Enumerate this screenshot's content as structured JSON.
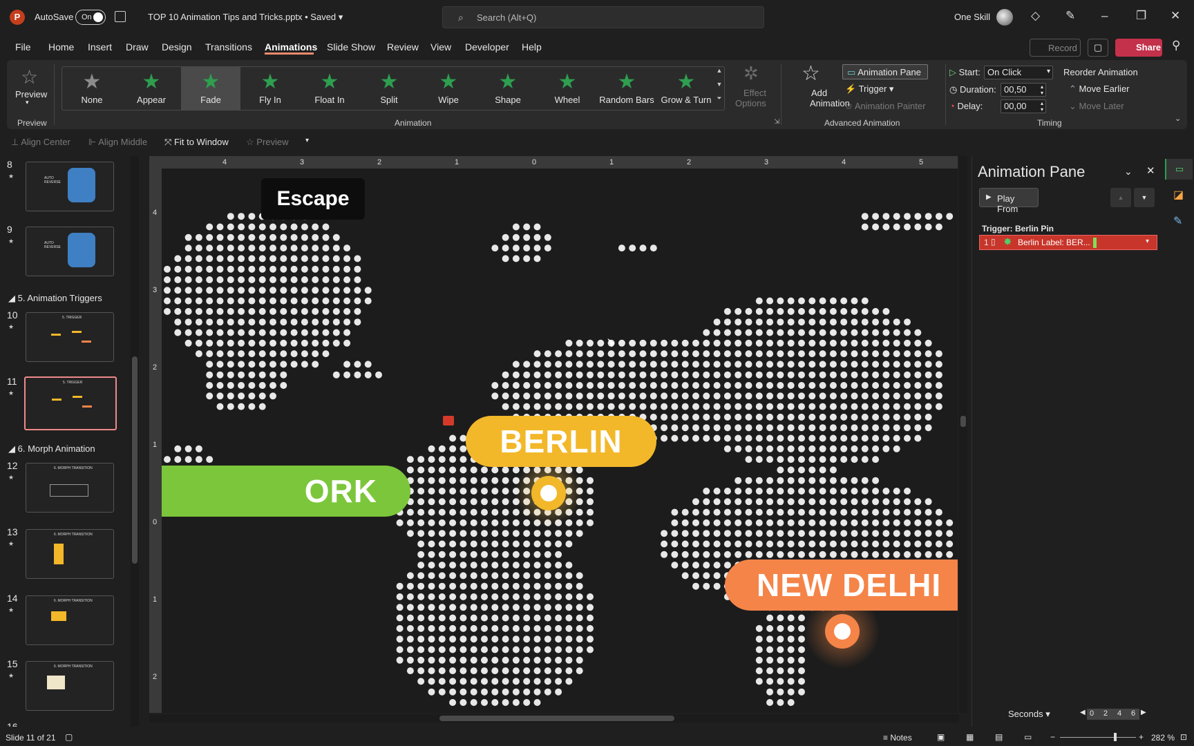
{
  "titlebar": {
    "logo": "P",
    "autosave_label": "AutoSave",
    "autosave_state": "On",
    "doc_title": "TOP 10 Animation Tips and Tricks.pptx • Saved",
    "search_placeholder": "Search (Alt+Q)",
    "user_name": "One Skill"
  },
  "menu": {
    "tabs": [
      "File",
      "Home",
      "Insert",
      "Draw",
      "Design",
      "Transitions",
      "Animations",
      "Slide Show",
      "Review",
      "View",
      "Developer",
      "Help"
    ],
    "record": "Record",
    "share": "Share"
  },
  "ribbon": {
    "preview": "Preview",
    "preview_group": "Preview",
    "animations": [
      "None",
      "Appear",
      "Fade",
      "Fly In",
      "Float In",
      "Split",
      "Wipe",
      "Shape",
      "Wheel",
      "Random Bars",
      "Grow & Turn"
    ],
    "selected_animation": "Fade",
    "effect_options_1": "Effect",
    "effect_options_2": "Options",
    "animation_group": "Animation",
    "add_animation_1": "Add",
    "add_animation_2": "Animation",
    "animation_pane": "Animation Pane",
    "trigger": "Trigger",
    "animation_painter": "Animation Painter",
    "advanced_group": "Advanced Animation",
    "start_label": "Start:",
    "start_value": "On Click",
    "duration_label": "Duration:",
    "duration_value": "00,50",
    "delay_label": "Delay:",
    "delay_value": "00,00",
    "timing_group": "Timing",
    "reorder": "Reorder Animation",
    "move_earlier": "Move Earlier",
    "move_later": "Move Later"
  },
  "quickbar": {
    "align_center": "Align Center",
    "align_middle": "Align Middle",
    "fit_window": "Fit to Window",
    "preview": "Preview"
  },
  "thumbs": {
    "slides": [
      {
        "num": "8",
        "title": "AUTO REVERSE"
      },
      {
        "num": "9",
        "title": "AUTO REVERSE"
      },
      {
        "num": "10",
        "title": "5. TRIGGER"
      },
      {
        "num": "11",
        "title": "5. TRIGGER"
      },
      {
        "num": "12",
        "title": "6. MORPH TRANSITION"
      },
      {
        "num": "13",
        "title": "6. MORPH TRANSITION"
      },
      {
        "num": "14",
        "title": "6. MORPH TRANSITION"
      },
      {
        "num": "15",
        "title": "6. MORPH TRANSITION"
      },
      {
        "num": "16",
        "title": ""
      }
    ],
    "section5": "5. Animation Triggers",
    "section6": "6. Morph Animation"
  },
  "rulers": {
    "h": [
      "4",
      "3",
      "2",
      "1",
      "0",
      "1",
      "2",
      "3",
      "4",
      "5"
    ],
    "v": [
      "4",
      "3",
      "2",
      "1",
      "0",
      "1",
      "2"
    ]
  },
  "slide": {
    "escape": "Escape",
    "york": "ORK",
    "berlin": "BERLIN",
    "delhi": "NEW DELHI",
    "colors": {
      "berlin": "#f2b82a",
      "york": "#7cc63b",
      "delhi": "#f58448",
      "trigger": "#d43a2a"
    }
  },
  "pane": {
    "title": "Animation Pane",
    "play_from": "Play From",
    "trigger_head": "Trigger: Berlin Pin",
    "item_num": "1",
    "item_label": "Berlin Label: BER...",
    "seconds": "Seconds",
    "timeline": [
      "0",
      "2",
      "4",
      "6"
    ]
  },
  "status": {
    "slide_info": "Slide 11 of 21",
    "notes": "Notes",
    "zoom": "282 %"
  }
}
